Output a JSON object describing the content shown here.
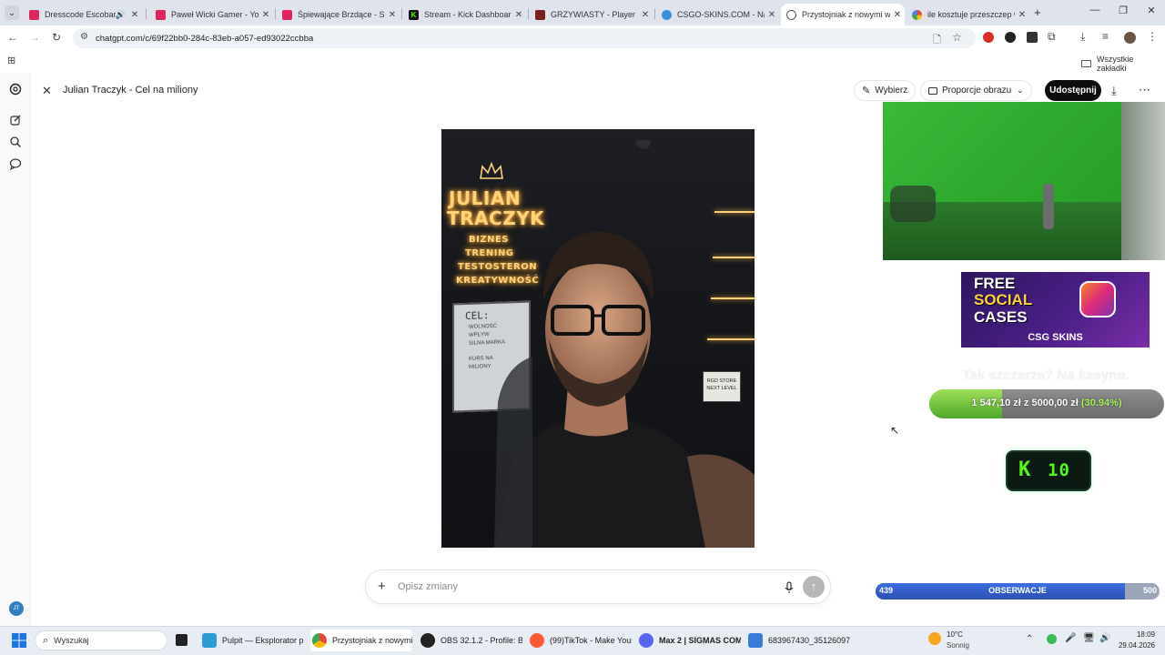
{
  "browser": {
    "tabs": [
      {
        "title": "Dresscode Escobar - Y",
        "fav_color": "#e0245e",
        "active": false
      },
      {
        "title": "Paweł Wicki Gamer - You",
        "fav_color": "#e0245e",
        "active": false
      },
      {
        "title": "Śpiewające Brzdące - Siln",
        "fav_color": "#e0245e",
        "active": false
      },
      {
        "title": "Stream - Kick Dashboard",
        "fav_color": "#53fc18",
        "active": false
      },
      {
        "title": "GRZYWIASTY - Player Pro",
        "fav_color": "#7a1f1f",
        "active": false
      },
      {
        "title": "CSGO-SKINS.COM - Najle",
        "fav_color": "#3a8fd6",
        "active": false
      },
      {
        "title": "Przystojniak z nowymi w",
        "fav_color": "#555555",
        "active": true
      },
      {
        "title": "ile kosztuje przeszczep wł",
        "fav_color": "#4285f4",
        "active": false
      }
    ],
    "new_tab_label": "+",
    "url": "chatgpt.com/c/69f22bb0-284c-83eb-a057-ed93022ccbba",
    "bookmarks_label": "Wszystkie zakładki"
  },
  "chatgpt": {
    "header_title": "Julian Traczyk - Cel na miliony",
    "select_label": "Wybierz",
    "aspect_label": "Proporcje obrazu",
    "share_label": "Udostępnij",
    "prompt_placeholder": "Opisz zmiany",
    "avatar_initials": "JT",
    "image": {
      "neon_name_1": "JULIAN",
      "neon_name_2": "TRACZYK",
      "neon_items": [
        "BIZNES",
        "TRENING",
        "TESTOSTERON",
        "KREATYWNOŚĆ"
      ],
      "board_title": "CEL:",
      "board_lines": [
        "WOLNOŚĆ",
        "WPŁYW",
        "SILNA MARKA"
      ],
      "board_lines_2": [
        "KURS NA",
        "MILIONY"
      ],
      "sign_lines": [
        "RGD STORE",
        "NEXT LEVEL"
      ]
    }
  },
  "overlays": {
    "ad_line1": "FREE",
    "ad_line2": "SOCIAL",
    "ad_line3": "CASES",
    "ad_brand": "CSG SKINS",
    "kasyno_text": "Tak szczerze? Na kasyno.",
    "progress_text": "1 547,10 zł",
    "progress_of": "z",
    "progress_goal": "5000,00 zł",
    "progress_pct": "(30.94%)",
    "progress_fraction": 0.3094,
    "kick_logo": "K",
    "kick_value": "10",
    "obs_left": "439",
    "obs_label": "OBSERWACJE",
    "obs_right": "500",
    "obs_fraction": 0.878
  },
  "taskbar": {
    "search_placeholder": "Wyszukaj",
    "items": [
      {
        "label": "Pulpit — Eksplorator pli",
        "color": "#2d9bd2"
      },
      {
        "label": "Przystojniak z nowymi w",
        "color": "#4285f4"
      },
      {
        "label": "OBS 32.1.2 - Profile: Bez",
        "color": "#333333"
      },
      {
        "label": "(99)TikTok - Make Your",
        "color": "#ff5a36"
      },
      {
        "label": "Max 2 | SIGMAS COMM",
        "color": "#5865f2"
      },
      {
        "label": "683967430_3512609712.",
        "color": "#3a7bd5"
      }
    ],
    "weather_temp": "10°C",
    "weather_desc": "Sonnig",
    "time": "18:09",
    "date": "29.04.2026"
  }
}
